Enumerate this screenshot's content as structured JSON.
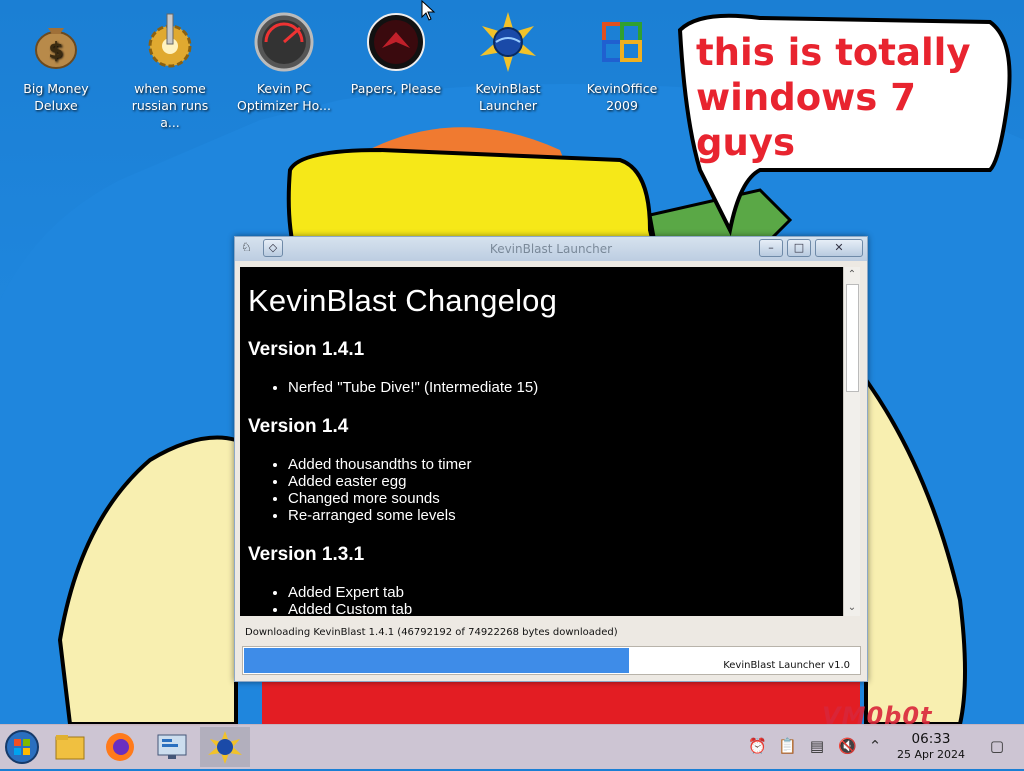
{
  "desktop": {
    "icons": [
      {
        "label_line1": "Big Money",
        "label_line2": "Deluxe"
      },
      {
        "label_line1": "when some",
        "label_line2": "russian runs a..."
      },
      {
        "label_line1": "Kevin PC",
        "label_line2": "Optimizer Ho..."
      },
      {
        "label_line1": "Papers, Please",
        "label_line2": ""
      },
      {
        "label_line1": "KevinBlast",
        "label_line2": "Launcher"
      },
      {
        "label_line1": "KevinOffice",
        "label_line2": "2009"
      }
    ],
    "speech_bubble": {
      "line1": "this is totally",
      "line2": "windows 7 guys"
    },
    "watermark": "VM0b0t"
  },
  "window": {
    "title": "KevinBlast Launcher",
    "changelog_title": "KevinBlast Changelog",
    "versions": [
      {
        "heading": "Version 1.4.1",
        "items": [
          "Nerfed \"Tube Dive!\" (Intermediate 15)"
        ]
      },
      {
        "heading": "Version 1.4",
        "items": [
          "Added thousandths to timer",
          "Added easter egg",
          "Changed more sounds",
          "Re-arranged some levels"
        ]
      },
      {
        "heading": "Version 1.3.1",
        "items": [
          "Added Expert tab",
          "Added Custom tab"
        ]
      }
    ],
    "status_text": "Downloading KevinBlast 1.4.1 (46792192 of 74922268 bytes downloaded)",
    "progress_fraction": 0.6245,
    "version_label": "KevinBlast Launcher v1.0"
  },
  "taskbar": {
    "clock_time": "06:33",
    "clock_date": "25 Apr 2024"
  }
}
